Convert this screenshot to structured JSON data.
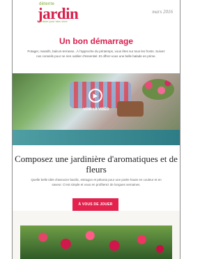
{
  "header": {
    "logo_small": "détente",
    "logo_main": "jardin",
    "logo_tag": "jardiner pour bien vivre",
    "date": "mars 2016"
  },
  "article": {
    "headline": "Un bon démarrage",
    "intro": "Potager, massifs, balcon-terrasse...À l'approche du printemps, vous êtes sur tous les fronts. Suivez nos conseils pour ne rien oublier d'essentiel. Et offrez-vous une belle balade en prime.",
    "video_label": "VOIR LA VIDÉO",
    "section_title": "Composez une jardinière d'aromatiques et de fleurs",
    "section_text": "Quelle belle idée d'associer basilic, estragon et pétunia pour une potée haute en couleur et en saveur. C'est simple et vous en profiterez de longues semaines.",
    "cta_label": "À VOUS DE JOUER"
  },
  "colors": {
    "accent": "#d9204d",
    "cta": "#e3224d"
  }
}
